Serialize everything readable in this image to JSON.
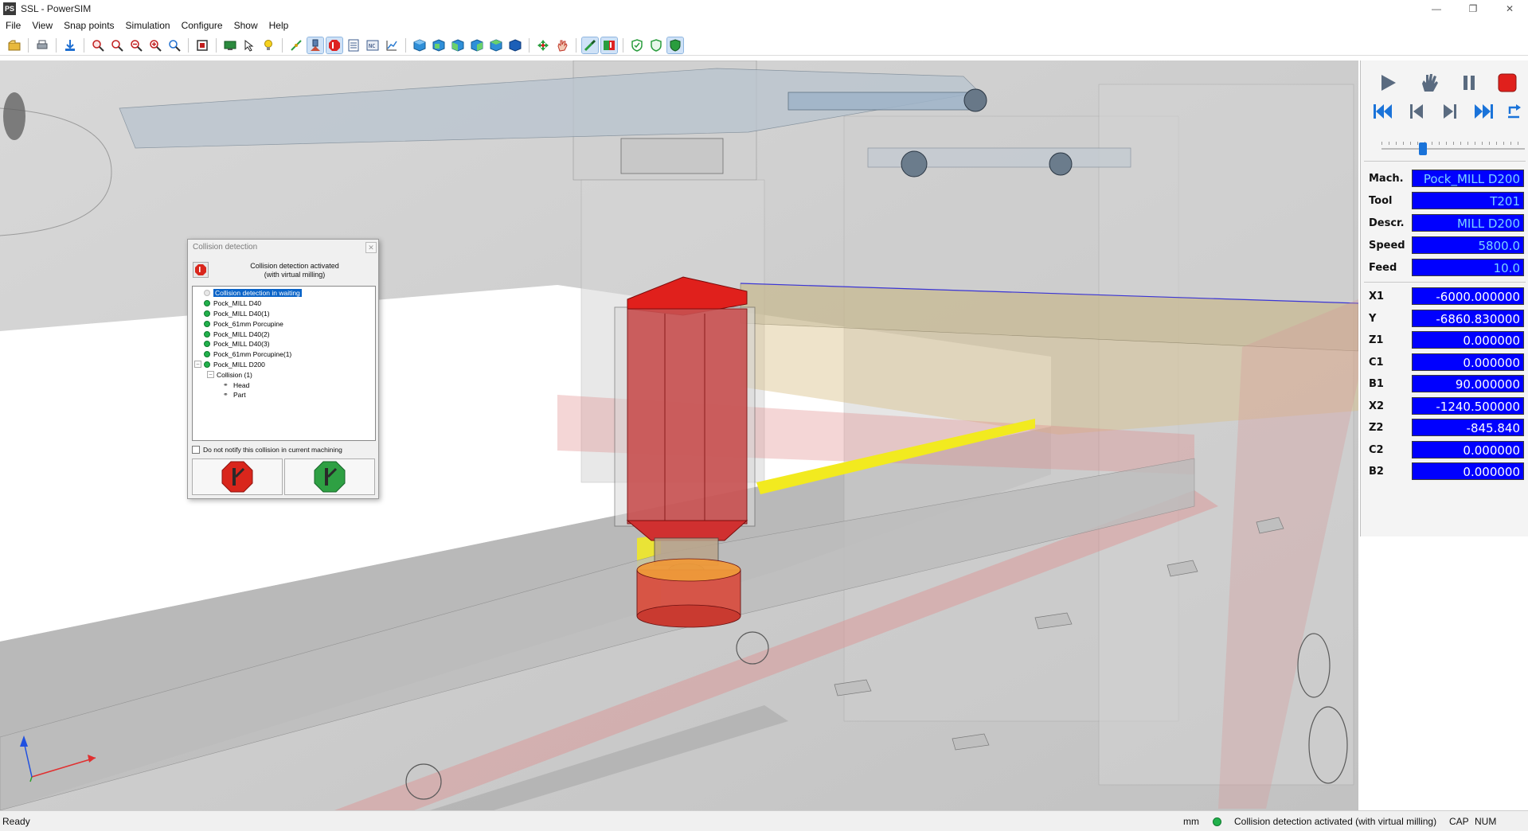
{
  "window": {
    "title": "SSL - PowerSIM",
    "app_icon_text": "PS"
  },
  "menu": [
    "File",
    "View",
    "Snap points",
    "Simulation",
    "Configure",
    "Show",
    "Help"
  ],
  "collision_dialog": {
    "title": "Collision detection",
    "heading_line1": "Collision detection activated",
    "heading_line2": "(with virtual milling)",
    "tree": [
      {
        "label": "Collision detection in waiting",
        "level": 0,
        "kind": "status",
        "selected": true
      },
      {
        "label": "Pock_MILL D40",
        "level": 0,
        "kind": "ok"
      },
      {
        "label": "Pock_MILL D40(1)",
        "level": 0,
        "kind": "ok"
      },
      {
        "label": "Pock_61mm Porcupine",
        "level": 0,
        "kind": "ok"
      },
      {
        "label": "Pock_MILL D40(2)",
        "level": 0,
        "kind": "ok"
      },
      {
        "label": "Pock_MILL D40(3)",
        "level": 0,
        "kind": "ok"
      },
      {
        "label": "Pock_61mm Porcupine(1)",
        "level": 0,
        "kind": "ok"
      },
      {
        "label": "Pock_MILL D200",
        "level": 0,
        "kind": "ok",
        "expanded": true
      },
      {
        "label": "Collision (1)",
        "level": 1,
        "kind": "group",
        "expanded": true
      },
      {
        "label": "Head",
        "level": 2,
        "kind": "link"
      },
      {
        "label": "Part",
        "level": 2,
        "kind": "link"
      }
    ],
    "notify_label": "Do not notify this collision in current machining",
    "notify_checked": false
  },
  "panel": {
    "slider_position": 0.29,
    "info": [
      {
        "label": "Mach.",
        "value": "Pock_MILL D200"
      },
      {
        "label": "Tool",
        "value": "T201"
      },
      {
        "label": "Descr.",
        "value": "MILL D200"
      },
      {
        "label": "Speed",
        "value": "5800.0"
      },
      {
        "label": "Feed",
        "value": "10.0"
      }
    ],
    "axes": [
      {
        "label": "X1",
        "value": "-6000.000000"
      },
      {
        "label": "Y",
        "value": "-6860.830000"
      },
      {
        "label": "Z1",
        "value": "0.000000"
      },
      {
        "label": "C1",
        "value": "0.000000"
      },
      {
        "label": "B1",
        "value": "90.000000"
      },
      {
        "label": "X2",
        "value": "-1240.500000"
      },
      {
        "label": "Z2",
        "value": "-845.840"
      },
      {
        "label": "C2",
        "value": "0.000000"
      },
      {
        "label": "B2",
        "value": "0.000000"
      }
    ]
  },
  "status": {
    "ready": "Ready",
    "units": "mm",
    "message": "Collision detection activated  (with virtual milling)",
    "cap": "CAP",
    "num": "NUM"
  },
  "colors": {
    "value_bg": "#0000ff",
    "value_text": "#7cd3ff",
    "ok_dot": "#22b14c",
    "collision_red": "#e0201c"
  }
}
